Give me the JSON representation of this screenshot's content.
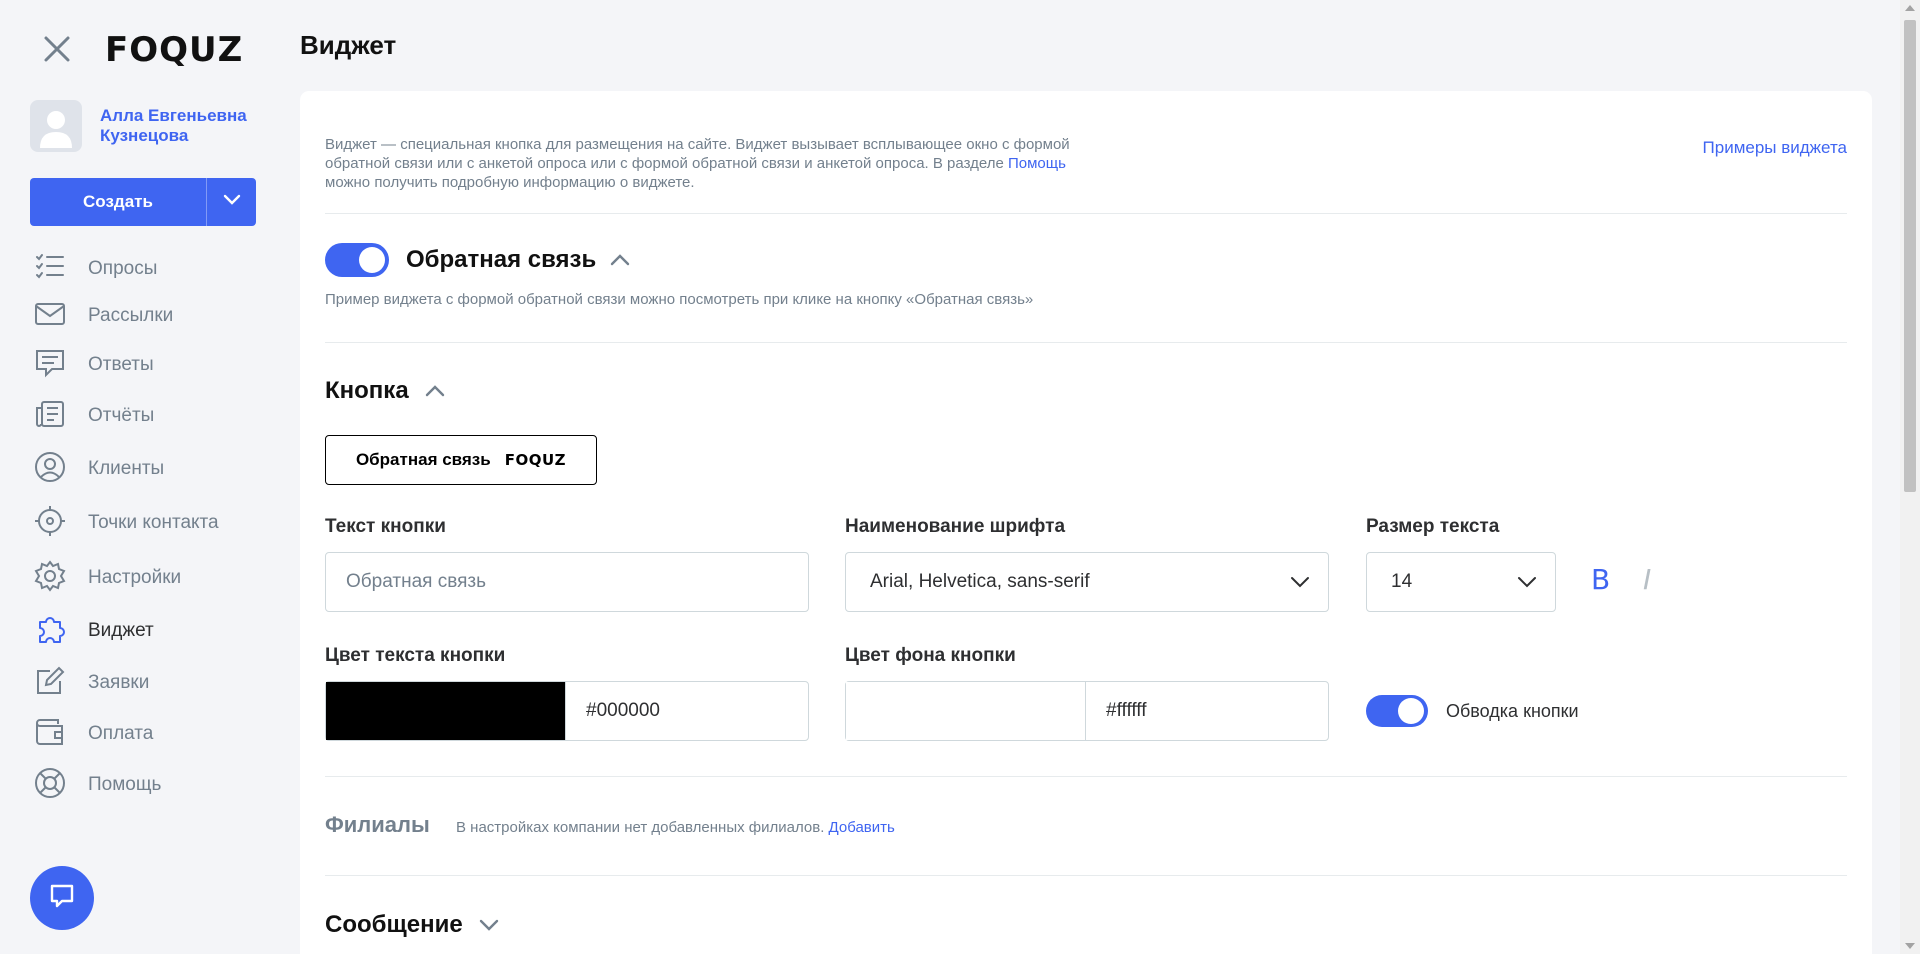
{
  "app": {
    "logo": "FOQUZ"
  },
  "user": {
    "name": "Алла Евгеньевна Кузнецова"
  },
  "create_button": {
    "label": "Создать"
  },
  "nav": [
    {
      "label": "Опросы",
      "icon": "list-check-icon",
      "active": false
    },
    {
      "label": "Рассылки",
      "icon": "mail-icon",
      "active": false
    },
    {
      "label": "Ответы",
      "icon": "message-icon",
      "active": false
    },
    {
      "label": "Отчёты",
      "icon": "report-icon",
      "active": false
    },
    {
      "label": "Клиенты",
      "icon": "user-circle-icon",
      "active": false
    },
    {
      "label": "Точки контакта",
      "icon": "target-icon",
      "active": false
    },
    {
      "label": "Настройки",
      "icon": "gear-icon",
      "active": false
    },
    {
      "label": "Виджет",
      "icon": "puzzle-icon",
      "active": true
    },
    {
      "label": "Заявки",
      "icon": "edit-icon",
      "active": false
    },
    {
      "label": "Оплата",
      "icon": "wallet-icon",
      "active": false
    },
    {
      "label": "Помощь",
      "icon": "lifebuoy-icon",
      "active": false
    }
  ],
  "page": {
    "title": "Виджет"
  },
  "intro": {
    "text_before": "Виджет — специальная кнопка для размещения на сайте. Виджет вызывает всплывающее окно с формой обратной связи или с анкетой опроса или с формой обратной связи и анкетой опроса. В разделе ",
    "help_link": "Помощь",
    "text_after": " можно получить подробную информацию о виджете.",
    "examples_link": "Примеры виджета"
  },
  "feedback": {
    "title": "Обратная связь",
    "enabled": true,
    "note": "Пример виджета с формой обратной связи можно посмотреть при клике на кнопку «Обратная связь»"
  },
  "button_section": {
    "title": "Кнопка",
    "preview_label": "Обратная связь",
    "preview_logo": "FOQUZ",
    "text_label": "Текст кнопки",
    "text_placeholder": "Обратная связь",
    "font_label": "Наименование шрифта",
    "font_value": "Arial, Helvetica, sans-serif",
    "size_label": "Размер текста",
    "size_value": "14",
    "bold_glyph": "B",
    "italic_glyph": "I",
    "text_color_label": "Цвет текста кнопки",
    "text_color_value": "#000000",
    "bg_color_label": "Цвет фона кнопки",
    "bg_color_value": "#ffffff",
    "outline_label": "Обводка кнопки",
    "outline_enabled": true
  },
  "branches": {
    "title": "Филиалы",
    "note": "В настройках компании нет добавленных филиалов.",
    "add_link": "Добавить"
  },
  "message": {
    "title": "Сообщение"
  },
  "colors": {
    "accent": "#3f65f1",
    "muted": "#73808d",
    "border": "#cfd8dc",
    "bg": "#f4f5f8"
  }
}
